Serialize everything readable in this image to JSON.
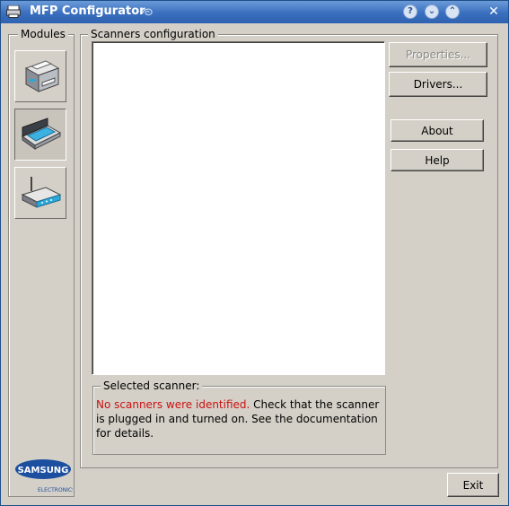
{
  "window": {
    "title": "MFP Configurator",
    "title_buttons": [
      "help-button",
      "minimize-button",
      "maximize-button",
      "close-button"
    ],
    "title_button_glyphs": {
      "help": "?",
      "minimize": "⌄",
      "maximize": "⌃",
      "close": "✕"
    }
  },
  "modules": {
    "label": "Modules",
    "items": [
      {
        "name": "printer",
        "icon": "printer-icon",
        "active": false
      },
      {
        "name": "scanner",
        "icon": "scanner-icon",
        "active": true
      },
      {
        "name": "port",
        "icon": "port-icon",
        "active": false
      }
    ]
  },
  "scanners": {
    "label": "Scanners configuration",
    "list_items": [],
    "buttons": {
      "properties": "Properties...",
      "drivers": "Drivers...",
      "about": "About",
      "help": "Help"
    },
    "selected": {
      "label": "Selected scanner:",
      "error": "No scanners were identified.",
      "message": " Check that the scanner is plugged in and turned on. See the documentation for details."
    }
  },
  "footer": {
    "exit": "Exit"
  },
  "brand": {
    "name": "SAMSUNG",
    "sub": "ELECTRONICS",
    "color": "#1d4fa0"
  }
}
